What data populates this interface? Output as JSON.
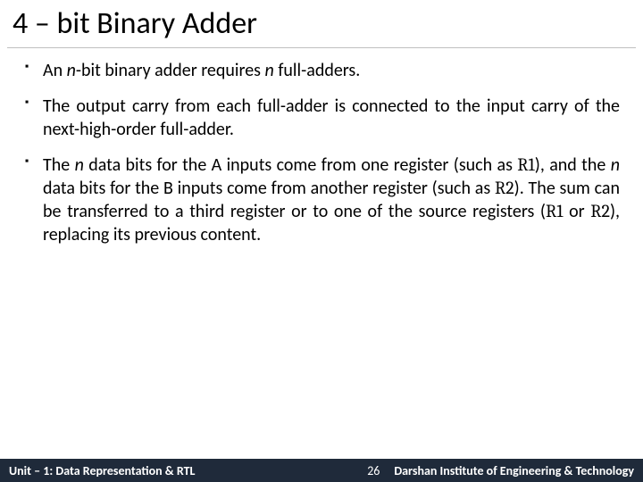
{
  "title": "4 – bit Binary Adder",
  "bullets": [
    {
      "pre": "An ",
      "em1": "n",
      "mid1": "-bit binary adder requires ",
      "em2": "n",
      "mid2": " full-adders.",
      "tail": ""
    },
    {
      "pre": "The output carry from each full-adder is connected to the input carry of the next-high-order full-adder.",
      "em1": "",
      "mid1": "",
      "em2": "",
      "mid2": "",
      "tail": ""
    },
    {
      "pre": "The ",
      "em1": "n",
      "mid1": " data bits for the A inputs come from one register (such as ",
      "r1": "R1",
      "mid2": "), and the ",
      "em2": "n",
      "mid3": " data bits for the B inputs come from another register (such as ",
      "r2": "R2",
      "mid4": "). The sum can be transferred to a third register or to one of the source registers (",
      "r3": "R1",
      "mid5": " or ",
      "r4": "R2",
      "tail": "), replacing its previous content."
    }
  ],
  "footer": {
    "unit": "Unit – 1: Data Representation & RTL",
    "page": "26",
    "org": "Darshan Institute of Engineering & Technology"
  }
}
